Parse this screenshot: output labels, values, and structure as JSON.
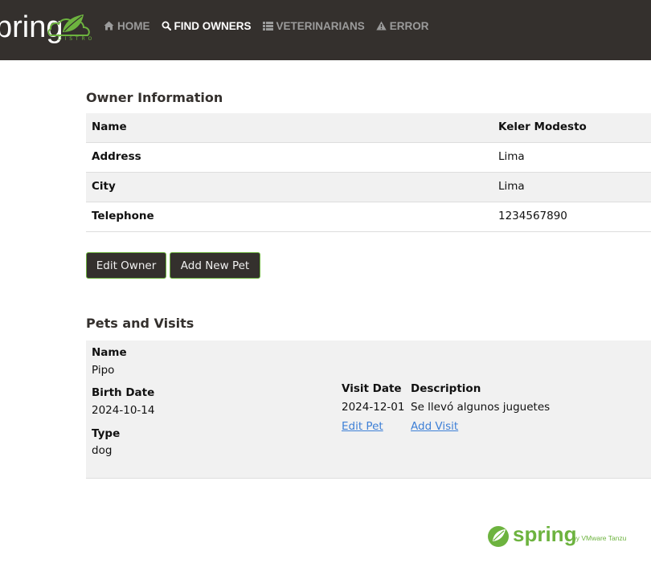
{
  "navbar": {
    "brand_text": "pring",
    "items": [
      {
        "label": "Home",
        "icon": "home-icon",
        "active": false
      },
      {
        "label": "Find owners",
        "icon": "search-icon",
        "active": true
      },
      {
        "label": "Veterinarians",
        "icon": "list-icon",
        "active": false
      },
      {
        "label": "Error",
        "icon": "warning-icon",
        "active": false
      }
    ]
  },
  "owner": {
    "heading": "Owner Information",
    "rows": [
      {
        "key": "Name",
        "value": "Keler Modesto"
      },
      {
        "key": "Address",
        "value": "Lima"
      },
      {
        "key": "City",
        "value": "Lima"
      },
      {
        "key": "Telephone",
        "value": "1234567890"
      }
    ],
    "edit_button": "Edit Owner",
    "add_pet_button": "Add New Pet"
  },
  "pets": {
    "heading": "Pets and Visits",
    "name_label": "Name",
    "birth_label": "Birth Date",
    "type_label": "Type",
    "items": [
      {
        "name": "Pipo",
        "birth_date": "2024-10-14",
        "type": "dog",
        "visit_date_header": "Visit Date",
        "description_header": "Description",
        "visits": [
          {
            "date": "2024-12-01",
            "description": "Se llevó algunos juguetes"
          }
        ],
        "edit_pet_link": "Edit Pet",
        "add_visit_link": "Add Visit"
      }
    ]
  },
  "footer": {
    "logo_text": "spring",
    "tagline": "by VMware Tanzu"
  },
  "colors": {
    "navbar_bg": "#34302d",
    "brand_green": "#6db33f",
    "link_blue": "#3d7fd6"
  }
}
